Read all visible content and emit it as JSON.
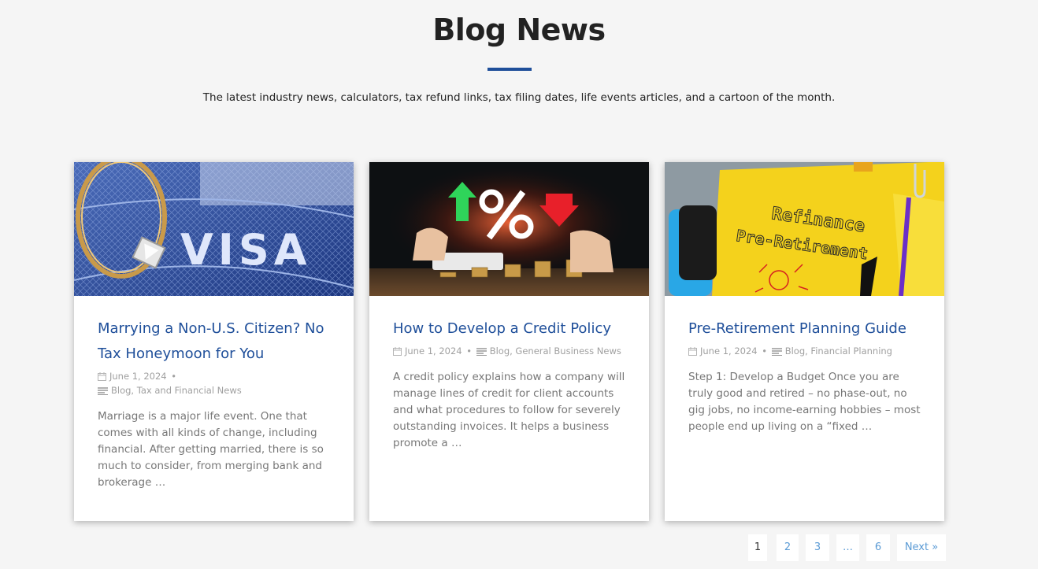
{
  "header": {
    "title": "Blog News",
    "subtitle": "The latest industry news, calculators, tax refund links, tax filing dates, life events articles, and a cartoon of the month."
  },
  "colors": {
    "accent": "#1f4f9a",
    "link": "#5b9bd5",
    "meta": "#a0a0a0"
  },
  "posts": [
    {
      "title": "Marrying a Non-U.S. Citizen? No Tax Honeymoon for You",
      "date": "June 1, 2024",
      "categories": "Blog, Tax and Financial News",
      "excerpt": "Marriage is a major life event. One that comes with all kinds of change, including financial. After getting married, there is so much to consider, from merging bank and brokerage …",
      "image_icon": "visa-ring-image"
    },
    {
      "title": "How to Develop a Credit Policy",
      "date": "June 1, 2024",
      "categories": "Blog, General Business News",
      "excerpt": "A credit policy explains how a company will manage lines of credit for client accounts and what procedures to follow for severely outstanding invoices. It helps a business promote a …",
      "image_icon": "percent-coins-image"
    },
    {
      "title": "Pre-Retirement Planning Guide",
      "date": "June 1, 2024",
      "categories": "Blog, Financial Planning",
      "excerpt": "Step 1: Develop a Budget Once you are truly good and retired – no phase-out, no gig jobs, no income-earning hobbies – most people end up living on a “fixed …",
      "image_icon": "notebook-image"
    }
  ],
  "image_text": {
    "visa": "VISA",
    "notebook_line1": "Refinance",
    "notebook_line2": "Pre-Retirement"
  },
  "pagination": {
    "pages": [
      "1",
      "2",
      "3",
      "…",
      "6"
    ],
    "current": "1",
    "next": "Next »"
  }
}
